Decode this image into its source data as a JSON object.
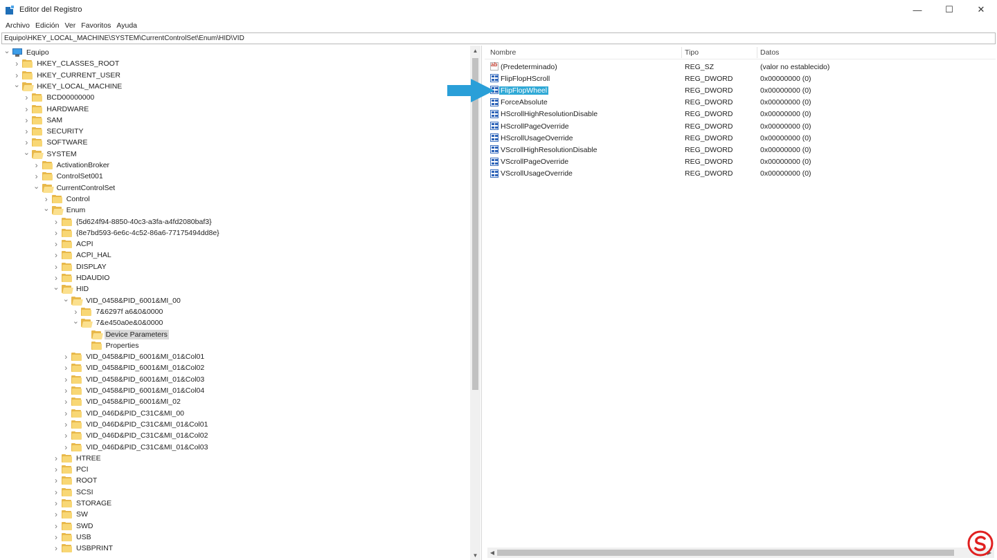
{
  "window": {
    "title": "Editor del Registro",
    "controls": {
      "minimize": "—",
      "maximize": "☐",
      "close": "✕"
    }
  },
  "menu": [
    "Archivo",
    "Edición",
    "Ver",
    "Favoritos",
    "Ayuda"
  ],
  "address": "Equipo\\HKEY_LOCAL_MACHINE\\SYSTEM\\CurrentControlSet\\Enum\\HID\\VID",
  "tree": [
    {
      "label": "Equipo",
      "depth": 0,
      "expanded": true,
      "type": "computer"
    },
    {
      "label": "HKEY_CLASSES_ROOT",
      "depth": 1,
      "expanded": false
    },
    {
      "label": "HKEY_CURRENT_USER",
      "depth": 1,
      "expanded": false
    },
    {
      "label": "HKEY_LOCAL_MACHINE",
      "depth": 1,
      "expanded": true
    },
    {
      "label": "BCD00000000",
      "depth": 2,
      "expanded": false
    },
    {
      "label": "HARDWARE",
      "depth": 2,
      "expanded": false
    },
    {
      "label": "SAM",
      "depth": 2,
      "expanded": false
    },
    {
      "label": "SECURITY",
      "depth": 2,
      "expanded": false
    },
    {
      "label": "SOFTWARE",
      "depth": 2,
      "expanded": false
    },
    {
      "label": "SYSTEM",
      "depth": 2,
      "expanded": true
    },
    {
      "label": "ActivationBroker",
      "depth": 3,
      "expanded": false
    },
    {
      "label": "ControlSet001",
      "depth": 3,
      "expanded": false
    },
    {
      "label": "CurrentControlSet",
      "depth": 3,
      "expanded": true
    },
    {
      "label": "Control",
      "depth": 4,
      "expanded": false
    },
    {
      "label": "Enum",
      "depth": 4,
      "expanded": true
    },
    {
      "label": "{5d624f94-8850-40c3-a3fa-a4fd2080baf3}",
      "depth": 5,
      "expanded": false
    },
    {
      "label": "{8e7bd593-6e6c-4c52-86a6-77175494dd8e}",
      "depth": 5,
      "expanded": false
    },
    {
      "label": "ACPI",
      "depth": 5,
      "expanded": false
    },
    {
      "label": "ACPI_HAL",
      "depth": 5,
      "expanded": false
    },
    {
      "label": "DISPLAY",
      "depth": 5,
      "expanded": false
    },
    {
      "label": "HDAUDIO",
      "depth": 5,
      "expanded": false
    },
    {
      "label": "HID",
      "depth": 5,
      "expanded": true
    },
    {
      "label": "VID_0458&PID_6001&MI_00",
      "depth": 6,
      "expanded": true
    },
    {
      "label": "7&6297f a6&0&0000",
      "depth": 7,
      "expanded": false
    },
    {
      "label": "7&e450a0e&0&0000",
      "depth": 7,
      "expanded": true
    },
    {
      "label": "Device Parameters",
      "depth": 8,
      "expanded": null,
      "selected": true
    },
    {
      "label": "Properties",
      "depth": 8,
      "expanded": null
    },
    {
      "label": "VID_0458&PID_6001&MI_01&Col01",
      "depth": 6,
      "expanded": false
    },
    {
      "label": "VID_0458&PID_6001&MI_01&Col02",
      "depth": 6,
      "expanded": false
    },
    {
      "label": "VID_0458&PID_6001&MI_01&Col03",
      "depth": 6,
      "expanded": false
    },
    {
      "label": "VID_0458&PID_6001&MI_01&Col04",
      "depth": 6,
      "expanded": false
    },
    {
      "label": "VID_0458&PID_6001&MI_02",
      "depth": 6,
      "expanded": false
    },
    {
      "label": "VID_046D&PID_C31C&MI_00",
      "depth": 6,
      "expanded": false
    },
    {
      "label": "VID_046D&PID_C31C&MI_01&Col01",
      "depth": 6,
      "expanded": false
    },
    {
      "label": "VID_046D&PID_C31C&MI_01&Col02",
      "depth": 6,
      "expanded": false
    },
    {
      "label": "VID_046D&PID_C31C&MI_01&Col03",
      "depth": 6,
      "expanded": false
    },
    {
      "label": "HTREE",
      "depth": 5,
      "expanded": false
    },
    {
      "label": "PCI",
      "depth": 5,
      "expanded": false
    },
    {
      "label": "ROOT",
      "depth": 5,
      "expanded": false
    },
    {
      "label": "SCSI",
      "depth": 5,
      "expanded": false
    },
    {
      "label": "STORAGE",
      "depth": 5,
      "expanded": false
    },
    {
      "label": "SW",
      "depth": 5,
      "expanded": false
    },
    {
      "label": "SWD",
      "depth": 5,
      "expanded": false
    },
    {
      "label": "USB",
      "depth": 5,
      "expanded": false
    },
    {
      "label": "USBPRINT",
      "depth": 5,
      "expanded": false
    }
  ],
  "columns": {
    "name": "Nombre",
    "type": "Tipo",
    "data": "Datos"
  },
  "values": [
    {
      "name": "(Predeterminado)",
      "type": "REG_SZ",
      "data": "(valor no establecido)",
      "icon": "string-value-icon"
    },
    {
      "name": "FlipFlopHScroll",
      "type": "REG_DWORD",
      "data": "0x00000000 (0)",
      "icon": "binary-value-icon"
    },
    {
      "name": "FlipFlopWheel",
      "type": "REG_DWORD",
      "data": "0x00000000 (0)",
      "icon": "binary-value-icon",
      "selected": true
    },
    {
      "name": "ForceAbsolute",
      "type": "REG_DWORD",
      "data": "0x00000000 (0)",
      "icon": "binary-value-icon"
    },
    {
      "name": "HScrollHighResolutionDisable",
      "type": "REG_DWORD",
      "data": "0x00000000 (0)",
      "icon": "binary-value-icon"
    },
    {
      "name": "HScrollPageOverride",
      "type": "REG_DWORD",
      "data": "0x00000000 (0)",
      "icon": "binary-value-icon"
    },
    {
      "name": "HScrollUsageOverride",
      "type": "REG_DWORD",
      "data": "0x00000000 (0)",
      "icon": "binary-value-icon"
    },
    {
      "name": "VScrollHighResolutionDisable",
      "type": "REG_DWORD",
      "data": "0x00000000 (0)",
      "icon": "binary-value-icon"
    },
    {
      "name": "VScrollPageOverride",
      "type": "REG_DWORD",
      "data": "0x00000000 (0)",
      "icon": "binary-value-icon"
    },
    {
      "name": "VScrollUsageOverride",
      "type": "REG_DWORD",
      "data": "0x00000000 (0)",
      "icon": "binary-value-icon"
    }
  ],
  "colors": {
    "selection": "#30a9d6",
    "tree_selection": "#d9d9d9",
    "folder": "#f8d775",
    "arrow": "#2a9fd8",
    "watermark": "#e02020"
  }
}
